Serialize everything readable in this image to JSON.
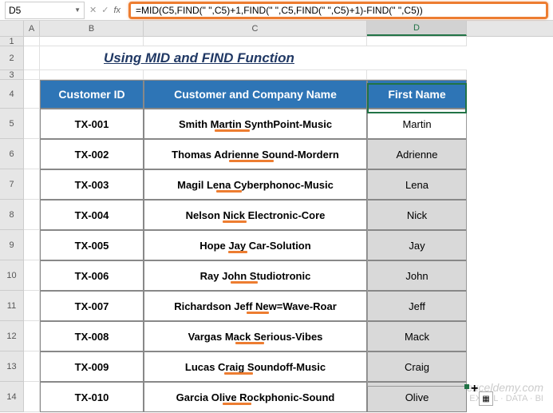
{
  "name_box": "D5",
  "formula": "=MID(C5,FIND(\" \",C5)+1,FIND(\" \",C5,FIND(\" \",C5)+1)-FIND(\" \",C5))",
  "cols": {
    "a": "A",
    "b": "B",
    "c": "C",
    "d": "D"
  },
  "row_nums": [
    "1",
    "2",
    "3",
    "4",
    "5",
    "6",
    "7",
    "8",
    "9",
    "10",
    "11",
    "12",
    "13",
    "14"
  ],
  "title": "Using MID and FIND Function",
  "headers": {
    "id": "Customer ID",
    "name": "Customer and Company Name",
    "first": "First Name"
  },
  "rows": [
    {
      "id": "TX-001",
      "name": "Smith Martin SynthPoint-Music",
      "first": "Martin"
    },
    {
      "id": "TX-002",
      "name": "Thomas Adrienne Sound-Mordern",
      "first": "Adrienne"
    },
    {
      "id": "TX-003",
      "name": "Magil Lena Cyberphonoc-Music",
      "first": "Lena"
    },
    {
      "id": "TX-004",
      "name": "Nelson Nick Electronic-Core",
      "first": "Nick"
    },
    {
      "id": "TX-005",
      "name": "Hope Jay Car-Solution",
      "first": "Jay"
    },
    {
      "id": "TX-006",
      "name": "Ray John Studiotronic",
      "first": "John"
    },
    {
      "id": "TX-007",
      "name": "Richardson Jeff New=Wave-Roar",
      "first": "Jeff"
    },
    {
      "id": "TX-008",
      "name": "Vargas Mack Serious-Vibes",
      "first": "Mack"
    },
    {
      "id": "TX-009",
      "name": "Lucas Craig Soundoff-Music",
      "first": "Craig"
    },
    {
      "id": "TX-010",
      "name": "Garcia Olive Rockphonic-Sound",
      "first": "Olive"
    }
  ],
  "watermark": {
    "line1": "exceldemy",
    "line2": ".com",
    "line3": "EXCEL · DATA · BI"
  }
}
